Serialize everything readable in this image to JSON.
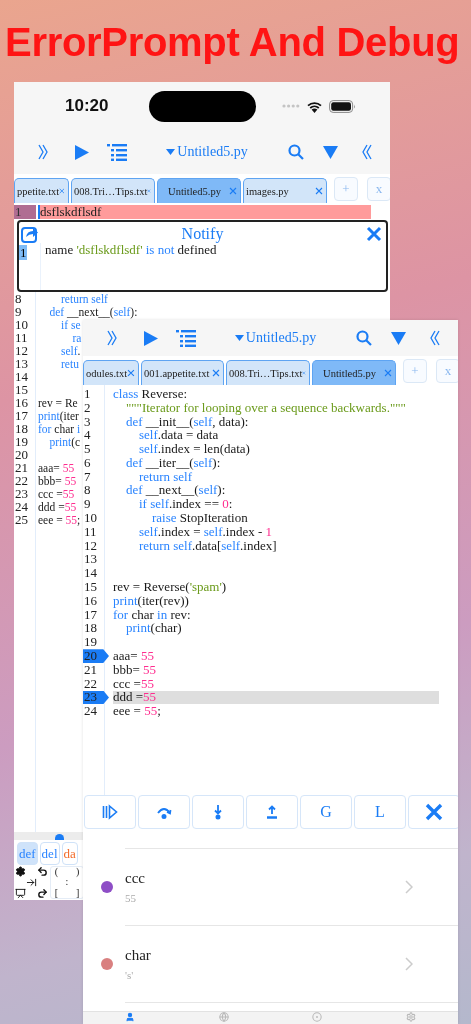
{
  "headline": "ErrorPrompt And Debug",
  "back_screen": {
    "status_bar": {
      "time": "10:20"
    },
    "toolbar": {
      "file_title": "Untitled5.py"
    },
    "tabs": [
      {
        "label": "ppetite.txt",
        "selected": false
      },
      {
        "label": "008.Tri…Tips.txt",
        "selected": false
      },
      {
        "label": "Untitled5.py",
        "selected": true
      },
      {
        "label": "images.py",
        "selected": false
      }
    ],
    "add_tab": "+",
    "close_tabs": "x",
    "error_line": {
      "number": "1",
      "text": "dsflskdflsdf"
    },
    "notify": {
      "title": "Notify",
      "messages": [
        {
          "number": "1",
          "tokens": [
            {
              "t": "name ",
              "kind": "plain"
            },
            {
              "t": "'dsflskdflsdf'",
              "kind": "string"
            },
            {
              "t": " is not",
              "kind": "keyword"
            },
            {
              "t": " defined",
              "kind": "plain"
            }
          ]
        }
      ]
    },
    "code_lines": [
      {
        "number": "8",
        "tokens": [
          {
            "t": "        return self",
            "kind": "keyword"
          }
        ]
      },
      {
        "number": "9",
        "tokens": [
          {
            "t": "    def",
            "kind": "keyword"
          },
          {
            "t": " __next__(",
            "kind": "plain"
          },
          {
            "t": "self",
            "kind": "keyword"
          },
          {
            "t": "):",
            "kind": "plain"
          }
        ]
      },
      {
        "number": "10",
        "tokens": [
          {
            "t": "        if se",
            "kind": "keyword"
          }
        ]
      },
      {
        "number": "11",
        "tokens": [
          {
            "t": "            ra",
            "kind": "keyword"
          }
        ]
      },
      {
        "number": "12",
        "tokens": [
          {
            "t": "        self",
            "kind": "keyword"
          },
          {
            "t": ".",
            "kind": "plain"
          }
        ]
      },
      {
        "number": "13",
        "tokens": [
          {
            "t": "        retu",
            "kind": "keyword"
          }
        ]
      },
      {
        "number": "14"
      },
      {
        "number": "15"
      },
      {
        "number": "16",
        "tokens": [
          {
            "t": "rev = Re",
            "kind": "plain"
          }
        ]
      },
      {
        "number": "17",
        "tokens": [
          {
            "t": "print",
            "kind": "keyword"
          },
          {
            "t": "(iter",
            "kind": "plain"
          }
        ]
      },
      {
        "number": "18",
        "tokens": [
          {
            "t": "for",
            "kind": "keyword"
          },
          {
            "t": " char ",
            "kind": "plain"
          },
          {
            "t": "i",
            "kind": "keyword"
          }
        ]
      },
      {
        "number": "19",
        "tokens": [
          {
            "t": "    print",
            "kind": "keyword"
          },
          {
            "t": "(c",
            "kind": "plain"
          }
        ]
      },
      {
        "number": "20"
      },
      {
        "number": "21",
        "tokens": [
          {
            "t": "aaa= ",
            "kind": "plain"
          },
          {
            "t": "55",
            "kind": "number"
          }
        ]
      },
      {
        "number": "22",
        "tokens": [
          {
            "t": "bbb= ",
            "kind": "plain"
          },
          {
            "t": "55",
            "kind": "number"
          }
        ]
      },
      {
        "number": "23",
        "tokens": [
          {
            "t": "ccc =",
            "kind": "plain"
          },
          {
            "t": "55",
            "kind": "number"
          }
        ]
      },
      {
        "number": "24",
        "tokens": [
          {
            "t": "ddd =",
            "kind": "plain"
          },
          {
            "t": "55",
            "kind": "number"
          }
        ]
      },
      {
        "number": "25",
        "tokens": [
          {
            "t": "eee = ",
            "kind": "plain"
          },
          {
            "t": "55",
            "kind": "number"
          },
          {
            "t": ";",
            "kind": "plain"
          }
        ]
      }
    ],
    "keyword_chips": [
      {
        "label": "def",
        "selected": true,
        "color": "#2a84ff"
      },
      {
        "label": "del",
        "selected": false,
        "color": "#2a84ff"
      },
      {
        "label": "da",
        "selected": false,
        "color": "#f26b2a"
      }
    ],
    "symbol_keys": [
      "(",
      ")",
      ":",
      "[",
      "]"
    ]
  },
  "front_screen": {
    "toolbar": {
      "file_title": "Untitled5.py"
    },
    "tabs": [
      {
        "label": "odules.txt",
        "selected": false
      },
      {
        "label": "001.appetite.txt",
        "selected": false
      },
      {
        "label": "008.Tri…Tips.txt",
        "selected": false
      },
      {
        "label": "Untitled5.py",
        "selected": true
      }
    ],
    "add_tab": "+",
    "close_tabs": "x",
    "code_lines": [
      {
        "number": "1",
        "breakpoint": false,
        "current": false,
        "tokens": [
          {
            "t": "class",
            "kind": "keyword"
          },
          {
            "t": " Reverse:",
            "kind": "plain"
          }
        ]
      },
      {
        "number": "2",
        "breakpoint": false,
        "current": false,
        "tokens": [
          {
            "t": "    \"\"\"Iterator for looping over a sequence backwards.\"\"\"",
            "kind": "string"
          }
        ]
      },
      {
        "number": "3",
        "breakpoint": false,
        "current": false,
        "tokens": [
          {
            "t": "    def",
            "kind": "keyword"
          },
          {
            "t": " __init__(",
            "kind": "plain"
          },
          {
            "t": "self",
            "kind": "keyword"
          },
          {
            "t": ", data):",
            "kind": "plain"
          }
        ]
      },
      {
        "number": "4",
        "breakpoint": false,
        "current": false,
        "tokens": [
          {
            "t": "        self",
            "kind": "keyword"
          },
          {
            "t": ".data = data",
            "kind": "plain"
          }
        ]
      },
      {
        "number": "5",
        "breakpoint": false,
        "current": false,
        "tokens": [
          {
            "t": "        self",
            "kind": "keyword"
          },
          {
            "t": ".index = len(data)",
            "kind": "plain"
          }
        ]
      },
      {
        "number": "6",
        "breakpoint": false,
        "current": false,
        "tokens": [
          {
            "t": "    def",
            "kind": "keyword"
          },
          {
            "t": " __iter__(",
            "kind": "plain"
          },
          {
            "t": "self",
            "kind": "keyword"
          },
          {
            "t": "):",
            "kind": "plain"
          }
        ]
      },
      {
        "number": "7",
        "breakpoint": false,
        "current": false,
        "tokens": [
          {
            "t": "        return self",
            "kind": "keyword"
          }
        ]
      },
      {
        "number": "8",
        "breakpoint": false,
        "current": false,
        "tokens": [
          {
            "t": "    def",
            "kind": "keyword"
          },
          {
            "t": " __next__(",
            "kind": "plain"
          },
          {
            "t": "self",
            "kind": "keyword"
          },
          {
            "t": "):",
            "kind": "plain"
          }
        ]
      },
      {
        "number": "9",
        "breakpoint": false,
        "current": false,
        "tokens": [
          {
            "t": "        if self",
            "kind": "keyword"
          },
          {
            "t": ".index == ",
            "kind": "plain"
          },
          {
            "t": "0",
            "kind": "number"
          },
          {
            "t": ":",
            "kind": "plain"
          }
        ]
      },
      {
        "number": "10",
        "breakpoint": false,
        "current": false,
        "tokens": [
          {
            "t": "            raise",
            "kind": "keyword"
          },
          {
            "t": " StopIteration",
            "kind": "plain"
          }
        ]
      },
      {
        "number": "11",
        "breakpoint": false,
        "current": false,
        "tokens": [
          {
            "t": "        self",
            "kind": "keyword"
          },
          {
            "t": ".index = ",
            "kind": "plain"
          },
          {
            "t": "self",
            "kind": "keyword"
          },
          {
            "t": ".index - ",
            "kind": "plain"
          },
          {
            "t": "1",
            "kind": "number"
          }
        ]
      },
      {
        "number": "12",
        "breakpoint": false,
        "current": false,
        "tokens": [
          {
            "t": "        return self",
            "kind": "keyword"
          },
          {
            "t": ".data[",
            "kind": "plain"
          },
          {
            "t": "self",
            "kind": "keyword"
          },
          {
            "t": ".index]",
            "kind": "plain"
          }
        ]
      },
      {
        "number": "13",
        "breakpoint": false,
        "current": false
      },
      {
        "number": "14",
        "breakpoint": false,
        "current": false
      },
      {
        "number": "15",
        "breakpoint": false,
        "current": false,
        "tokens": [
          {
            "t": "rev = Reverse(",
            "kind": "plain"
          },
          {
            "t": "'spam'",
            "kind": "string"
          },
          {
            "t": ")",
            "kind": "plain"
          }
        ]
      },
      {
        "number": "16",
        "breakpoint": false,
        "current": false,
        "tokens": [
          {
            "t": "print",
            "kind": "keyword"
          },
          {
            "t": "(iter(rev))",
            "kind": "plain"
          }
        ]
      },
      {
        "number": "17",
        "breakpoint": false,
        "current": false,
        "tokens": [
          {
            "t": "for",
            "kind": "keyword"
          },
          {
            "t": " char ",
            "kind": "plain"
          },
          {
            "t": "in",
            "kind": "keyword"
          },
          {
            "t": " rev:",
            "kind": "plain"
          }
        ]
      },
      {
        "number": "18",
        "breakpoint": false,
        "current": false,
        "tokens": [
          {
            "t": "    print",
            "kind": "keyword"
          },
          {
            "t": "(char)",
            "kind": "plain"
          }
        ]
      },
      {
        "number": "19",
        "breakpoint": false,
        "current": false
      },
      {
        "number": "20",
        "breakpoint": true,
        "current": false,
        "tokens": [
          {
            "t": "aaa= ",
            "kind": "plain"
          },
          {
            "t": "55",
            "kind": "number"
          }
        ]
      },
      {
        "number": "21",
        "breakpoint": false,
        "current": false,
        "tokens": [
          {
            "t": "bbb= ",
            "kind": "plain"
          },
          {
            "t": "55",
            "kind": "number"
          }
        ]
      },
      {
        "number": "22",
        "breakpoint": false,
        "current": false,
        "tokens": [
          {
            "t": "ccc =",
            "kind": "plain"
          },
          {
            "t": "55",
            "kind": "number"
          }
        ]
      },
      {
        "number": "23",
        "breakpoint": true,
        "current": true,
        "tokens": [
          {
            "t": "ddd =",
            "kind": "plain"
          },
          {
            "t": "55",
            "kind": "number"
          }
        ]
      },
      {
        "number": "24",
        "breakpoint": false,
        "current": false,
        "tokens": [
          {
            "t": "eee = ",
            "kind": "plain"
          },
          {
            "t": "55",
            "kind": "number"
          },
          {
            "t": ";",
            "kind": "plain"
          }
        ]
      }
    ],
    "debug_buttons": [
      {
        "kind": "continue"
      },
      {
        "kind": "step_over"
      },
      {
        "kind": "step_into"
      },
      {
        "kind": "step_out"
      },
      {
        "kind": "text",
        "label": "G"
      },
      {
        "kind": "text",
        "label": "L"
      },
      {
        "kind": "close"
      }
    ],
    "variables": [
      {
        "name": "ccc",
        "value": "55",
        "color": "#8e4ec6"
      },
      {
        "name": "char",
        "value": "'s'",
        "color": "#d98080"
      }
    ],
    "bottom_tabs": [
      {
        "kind": "person",
        "selected": true
      },
      {
        "kind": "globe",
        "selected": false
      },
      {
        "kind": "target",
        "selected": false
      },
      {
        "kind": "gear",
        "selected": false
      }
    ]
  }
}
